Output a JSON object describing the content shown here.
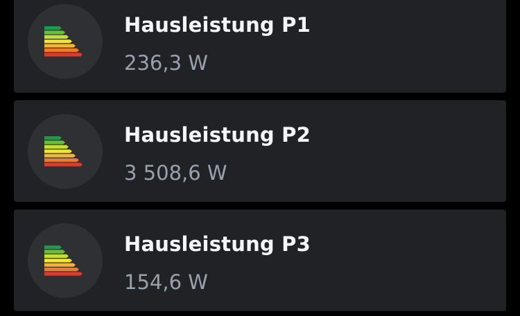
{
  "sensors": [
    {
      "title": "Hausleistung P1",
      "value": "236,3 W",
      "icon": "energy-label-icon"
    },
    {
      "title": "Hausleistung P2",
      "value": "3 508,6 W",
      "icon": "energy-label-icon"
    },
    {
      "title": "Hausleistung P3",
      "value": "154,6 W",
      "icon": "energy-label-icon"
    }
  ],
  "colors": {
    "page_background": "#000000",
    "card_background": "#212226",
    "icon_badge_background": "#2e3034",
    "title_text": "#f4f5f7",
    "value_text": "#9aa1ad",
    "energy_scale": [
      "#1f9a4a",
      "#69bd3f",
      "#c5de35",
      "#f3e62e",
      "#f6b52f",
      "#ef7a2a",
      "#e5372a"
    ]
  }
}
